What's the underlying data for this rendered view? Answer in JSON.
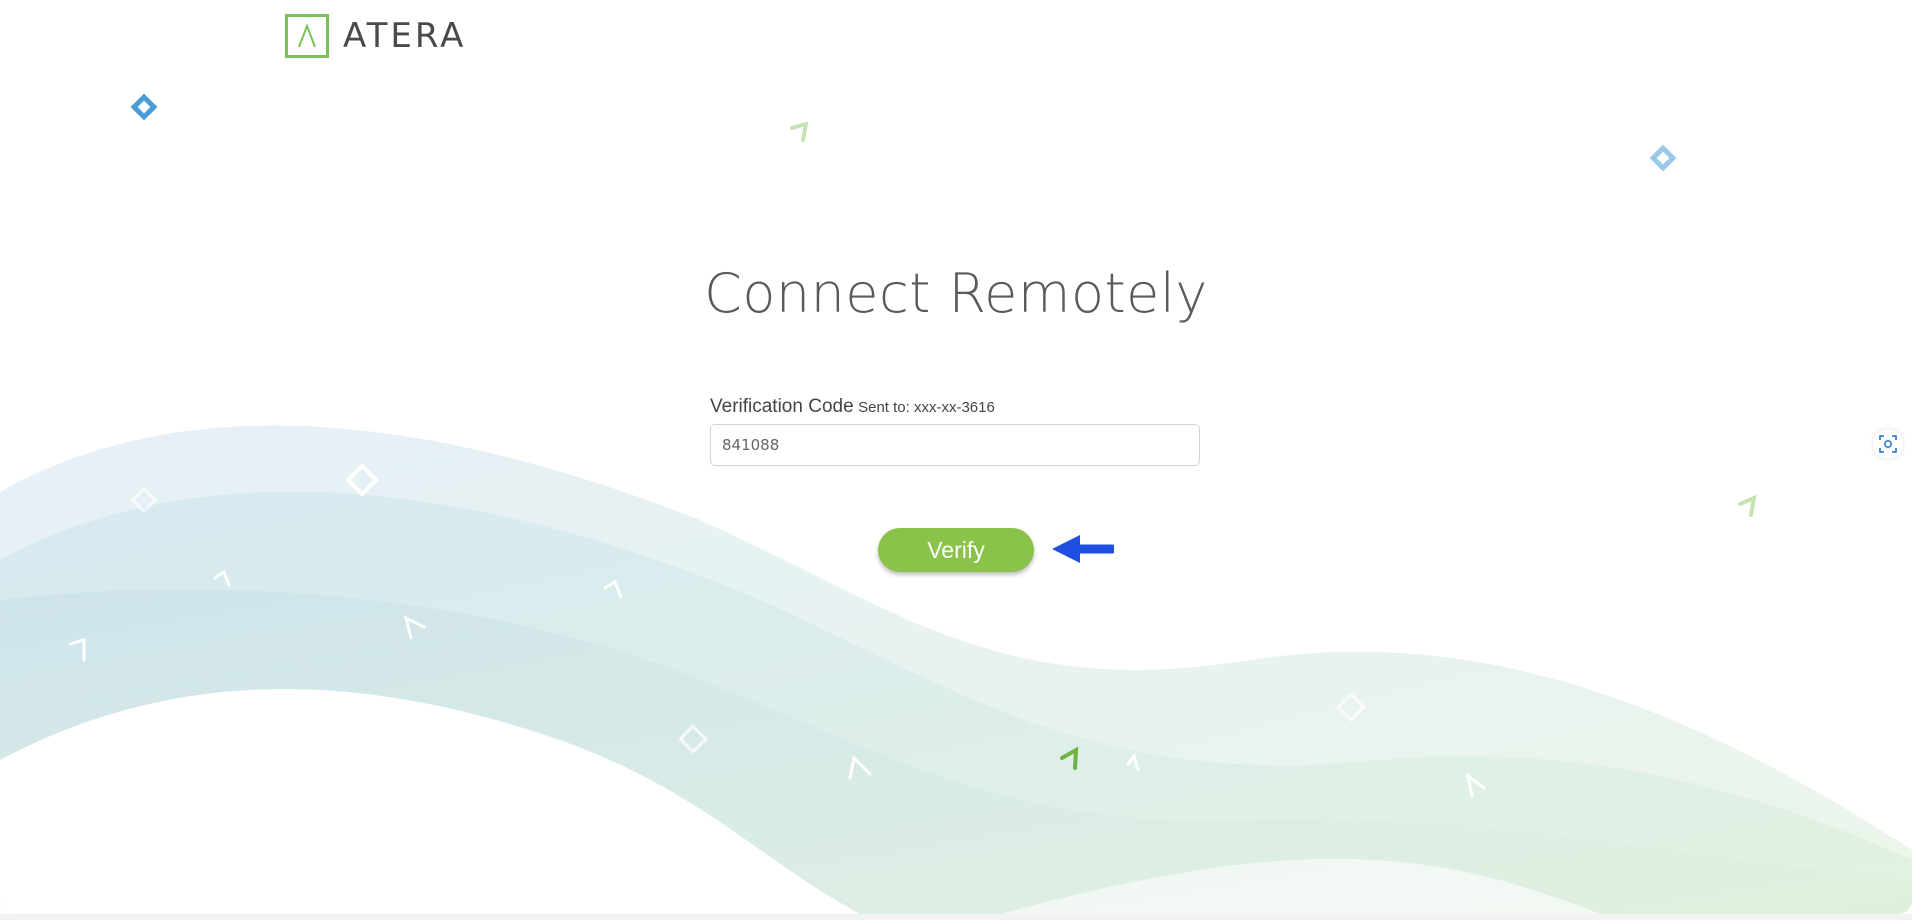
{
  "brand": {
    "name": "ATERA",
    "accent": "#8bc34a",
    "logo_green": "#78c257"
  },
  "page": {
    "title": "Connect Remotely"
  },
  "form": {
    "label": "Verification Code",
    "sent_to": "Sent to: xxx-xx-3616",
    "code_value": "841088"
  },
  "actions": {
    "verify_label": "Verify"
  },
  "icons": {
    "annotation": "left-arrow-icon",
    "side_tool": "screen-scan-icon"
  }
}
